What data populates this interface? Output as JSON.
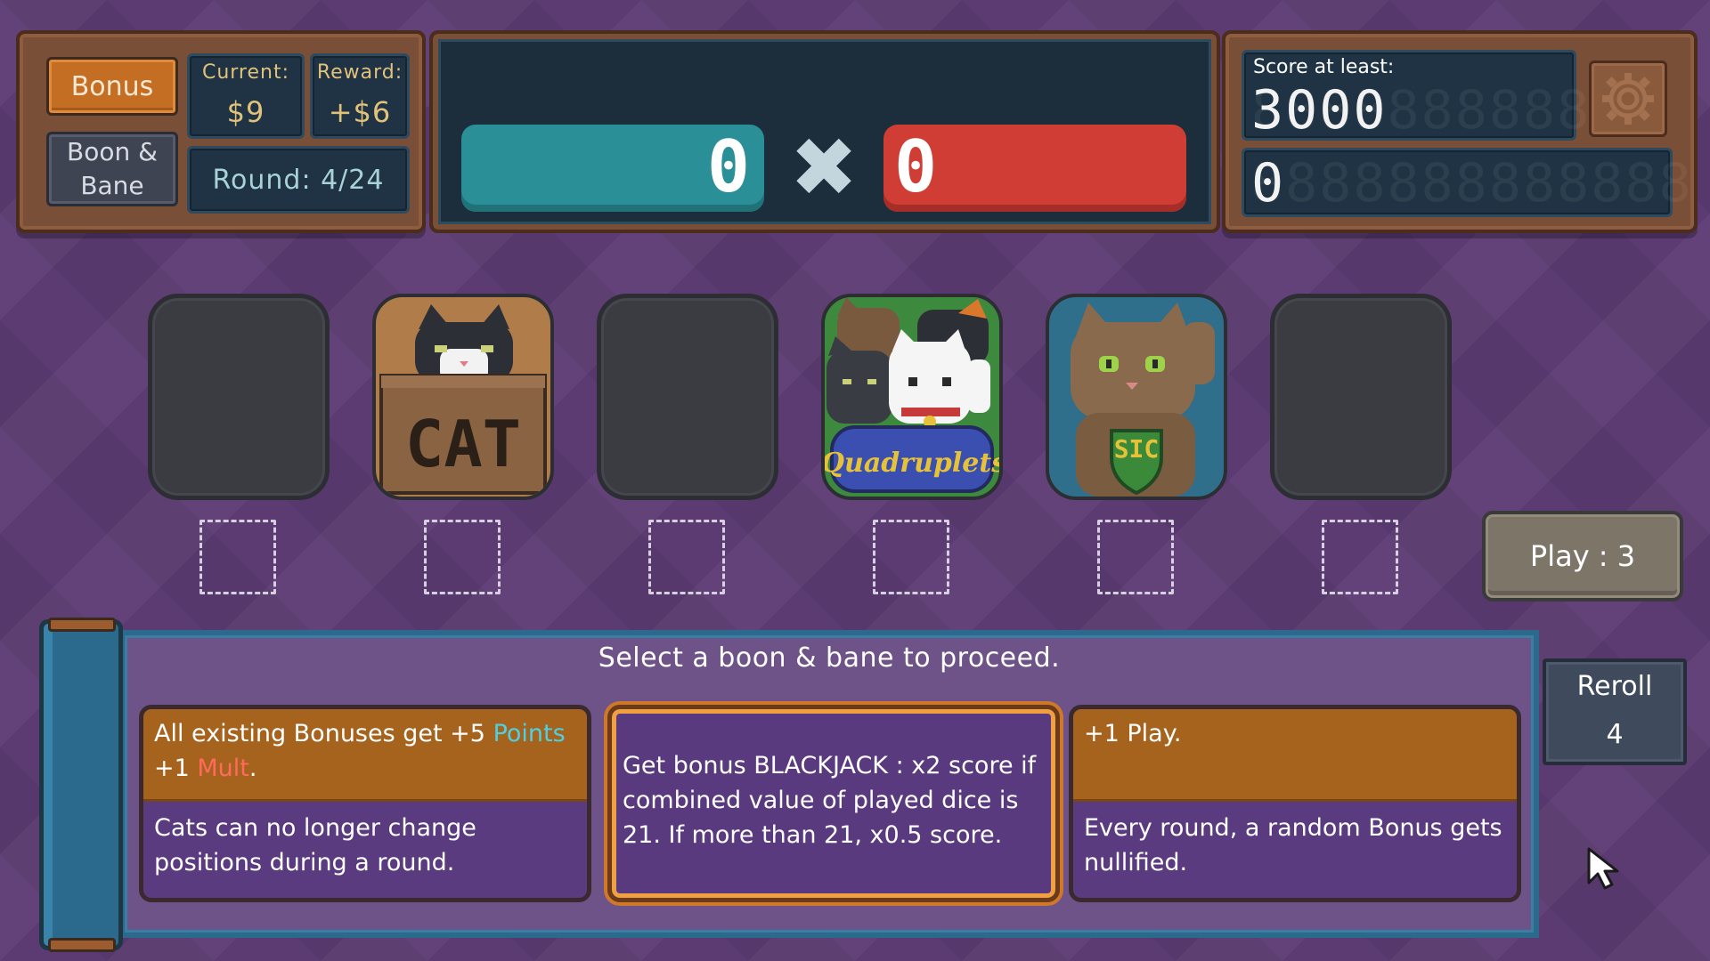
{
  "top_left": {
    "bonus_label": "Bonus",
    "boon_bane_label": "Boon &\nBane",
    "current_label": "Current:",
    "current_value": "$9",
    "reward_label": "Reward:",
    "reward_value": "+$6",
    "round_text": "Round: 4/24"
  },
  "scoring": {
    "points_value": "0",
    "mult_value": "0",
    "times_symbol": "✖"
  },
  "target": {
    "score_label": "Score at least:",
    "target_score": "3000",
    "current_score": "0"
  },
  "cats": [
    {
      "type": "empty"
    },
    {
      "type": "cat",
      "label": "CAT"
    },
    {
      "type": "empty"
    },
    {
      "type": "cat",
      "label": "Quadruplets"
    },
    {
      "type": "cat",
      "label": "SIC"
    },
    {
      "type": "empty"
    }
  ],
  "play_button": "Play : 3",
  "prompt": "Select a boon & bane to proceed.",
  "choices": [
    {
      "boon_part1": "All existing Bonuses get +5 ",
      "boon_points_word": "Points",
      "boon_part2": "+1 ",
      "boon_mult_word": "Mult",
      "boon_part3": ".",
      "bane": "Cats can no longer change positions during a round."
    },
    {
      "text": "Get bonus BLACKJACK : x2 score if combined value of played dice is 21. If more than 21, x0.5 score."
    },
    {
      "boon": "+1 Play.",
      "bane": "Every round, a random Bonus gets nullified."
    }
  ],
  "reroll": {
    "label": "Reroll",
    "count": "4"
  },
  "colors": {
    "points": "#2a8f96",
    "mult": "#cf3d35",
    "wood": "#7a4f37",
    "bonus_button": "#c46e24",
    "points_keyword": "#4ed0e0",
    "mult_keyword": "#ff6a5c"
  },
  "icons": [
    "gear-icon",
    "cursor-icon"
  ]
}
